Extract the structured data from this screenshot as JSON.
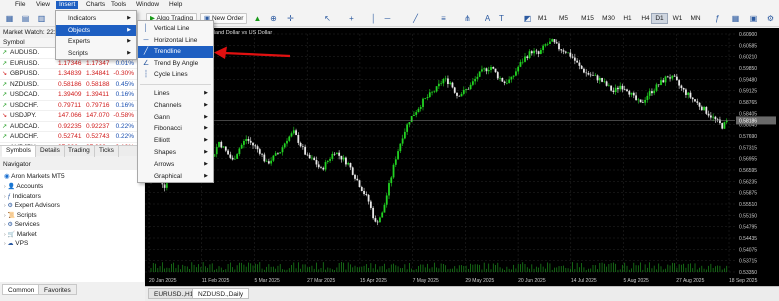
{
  "colors": {
    "accent": "#1e5fc2",
    "bull": "#22d322",
    "bear": "#e8e8e8",
    "price_line": "#8a8a8a",
    "arrow": "#e01010"
  },
  "menubar": {
    "items": [
      "File",
      "View",
      "Insert",
      "Charts",
      "Tools",
      "Window",
      "Help"
    ],
    "active": "Insert"
  },
  "toolbar": {
    "algo_trading": "Algo Trading",
    "new_order": "New Order",
    "timeframes": [
      "M1",
      "M5",
      "M15",
      "M30",
      "H1",
      "H4",
      "D1",
      "W1",
      "MN"
    ],
    "active_timeframe": "D1"
  },
  "market_watch": {
    "title": "Market Watch: 22:05",
    "header": {
      "symbol": "Symbol"
    },
    "rows": [
      {
        "symbol": "AUDUSD.",
        "bid": "",
        "ask": "",
        "change": ""
      },
      {
        "symbol": "EURUSD.",
        "bid": "1.17346",
        "ask": "1.17347",
        "change": "0.01%"
      },
      {
        "symbol": "GBPUSD.",
        "bid": "1.34839",
        "ask": "1.34841",
        "change": "-0.30%"
      },
      {
        "symbol": "NZDUSD.",
        "bid": "0.58186",
        "ask": "0.58188",
        "change": "0.45%"
      },
      {
        "symbol": "USDCAD.",
        "bid": "1.39409",
        "ask": "1.39411",
        "change": "0.16%"
      },
      {
        "symbol": "USDCHF.",
        "bid": "0.79711",
        "ask": "0.79716",
        "change": "0.16%"
      },
      {
        "symbol": "USDJPY.",
        "bid": "147.066",
        "ask": "147.070",
        "change": "-0.58%"
      },
      {
        "symbol": "AUDCAD.",
        "bid": "0.92235",
        "ask": "0.92237",
        "change": "0.22%"
      },
      {
        "symbol": "AUDCHF.",
        "bid": "0.52741",
        "ask": "0.52743",
        "change": "0.22%"
      },
      {
        "symbol": "AUDJPY.",
        "bid": "97.336",
        "ask": "97.339",
        "change": "-0.13%"
      }
    ],
    "tabs": [
      "Symbols",
      "Details",
      "Trading",
      "Ticks"
    ],
    "active_tab": "Symbols"
  },
  "navigator": {
    "title": "Navigator",
    "root": "Aron Markets MT5",
    "items": [
      "Accounts",
      "Indicators",
      "Expert Advisors",
      "Scripts",
      "Services",
      "Market",
      "VPS"
    ],
    "tabs": [
      "Common",
      "Favorites"
    ],
    "active_tab": "Common"
  },
  "chart": {
    "symbol_line": "NZDUSD., Daily: New Zealand Dollar vs US Dollar",
    "y_ticks": [
      "0.60900",
      "0.60585",
      "0.60210",
      "0.59850",
      "0.59480",
      "0.59125",
      "0.58765",
      "0.58405",
      "0.58045",
      "0.57690",
      "0.57315",
      "0.56955",
      "0.56595",
      "0.56235",
      "0.55875",
      "0.55510",
      "0.55150",
      "0.54795",
      "0.54435",
      "0.54075",
      "0.53715",
      "0.53350"
    ],
    "current_price": "0.58186",
    "x_ticks": [
      "20 Jan 2025",
      "11 Feb 2025",
      "5 Mar 2025",
      "27 Mar 2025",
      "15 Apr 2025",
      "7 May 2025",
      "29 May 2025",
      "20 Jun 2025",
      "14 Jul 2025",
      "5 Aug 2025",
      "27 Aug 2025",
      "18 Sep 2025"
    ],
    "tabs": [
      "EURUSD.,H1",
      "NZDUSD.,Daily"
    ],
    "active_tab": "NZDUSD.,Daily"
  },
  "chart_data": {
    "type": "candlestick",
    "symbol": "NZDUSD.",
    "timeframe": "Daily",
    "ylim": [
      0.5334,
      0.6095
    ],
    "x_range": [
      "20 Jan 2025",
      "24 Sep 2025"
    ],
    "close_path": [
      0.562,
      0.564,
      0.561,
      0.566,
      0.569,
      0.564,
      0.566,
      0.57,
      0.573,
      0.57,
      0.575,
      0.572,
      0.569,
      0.573,
      0.576,
      0.574,
      0.572,
      0.568,
      0.57,
      0.572,
      0.576,
      0.578,
      0.574,
      0.57,
      0.569,
      0.566,
      0.569,
      0.572,
      0.57,
      0.568,
      0.564,
      0.56,
      0.556,
      0.549,
      0.552,
      0.561,
      0.57,
      0.577,
      0.582,
      0.585,
      0.588,
      0.59,
      0.592,
      0.595,
      0.594,
      0.59,
      0.591,
      0.593,
      0.596,
      0.598,
      0.599,
      0.596,
      0.594,
      0.595,
      0.599,
      0.602,
      0.604,
      0.603,
      0.606,
      0.607,
      0.605,
      0.604,
      0.602,
      0.599,
      0.597,
      0.596,
      0.595,
      0.593,
      0.591,
      0.593,
      0.592,
      0.589,
      0.587,
      0.59,
      0.592,
      0.594,
      0.596,
      0.595,
      0.592,
      0.59,
      0.588,
      0.586,
      0.584,
      0.582,
      0.58,
      0.5819
    ]
  },
  "insert_menu": {
    "items": [
      {
        "label": "Indicators",
        "submenu": true
      },
      {
        "label": "Objects",
        "submenu": true,
        "highlighted": true
      },
      {
        "label": "Experts",
        "submenu": true
      },
      {
        "label": "Scripts",
        "submenu": true
      }
    ]
  },
  "objects_menu": {
    "items": [
      {
        "label": "Vertical Line",
        "icon": "vertical-line-icon",
        "glyph": "│"
      },
      {
        "label": "Horizontal Line",
        "icon": "horizontal-line-icon",
        "glyph": "─"
      },
      {
        "label": "Trendline",
        "icon": "trendline-icon",
        "glyph": "╱",
        "highlighted": true
      },
      {
        "label": "Trend By Angle",
        "icon": "trend-angle-icon",
        "glyph": "∠"
      },
      {
        "label": "Cycle Lines",
        "icon": "cycle-lines-icon",
        "glyph": "┆"
      }
    ],
    "groups": [
      {
        "label": "Lines"
      },
      {
        "label": "Channels"
      },
      {
        "label": "Gann"
      },
      {
        "label": "Fibonacci"
      },
      {
        "label": "Elliott"
      },
      {
        "label": "Shapes"
      },
      {
        "label": "Arrows"
      },
      {
        "label": "Graphical"
      }
    ]
  }
}
